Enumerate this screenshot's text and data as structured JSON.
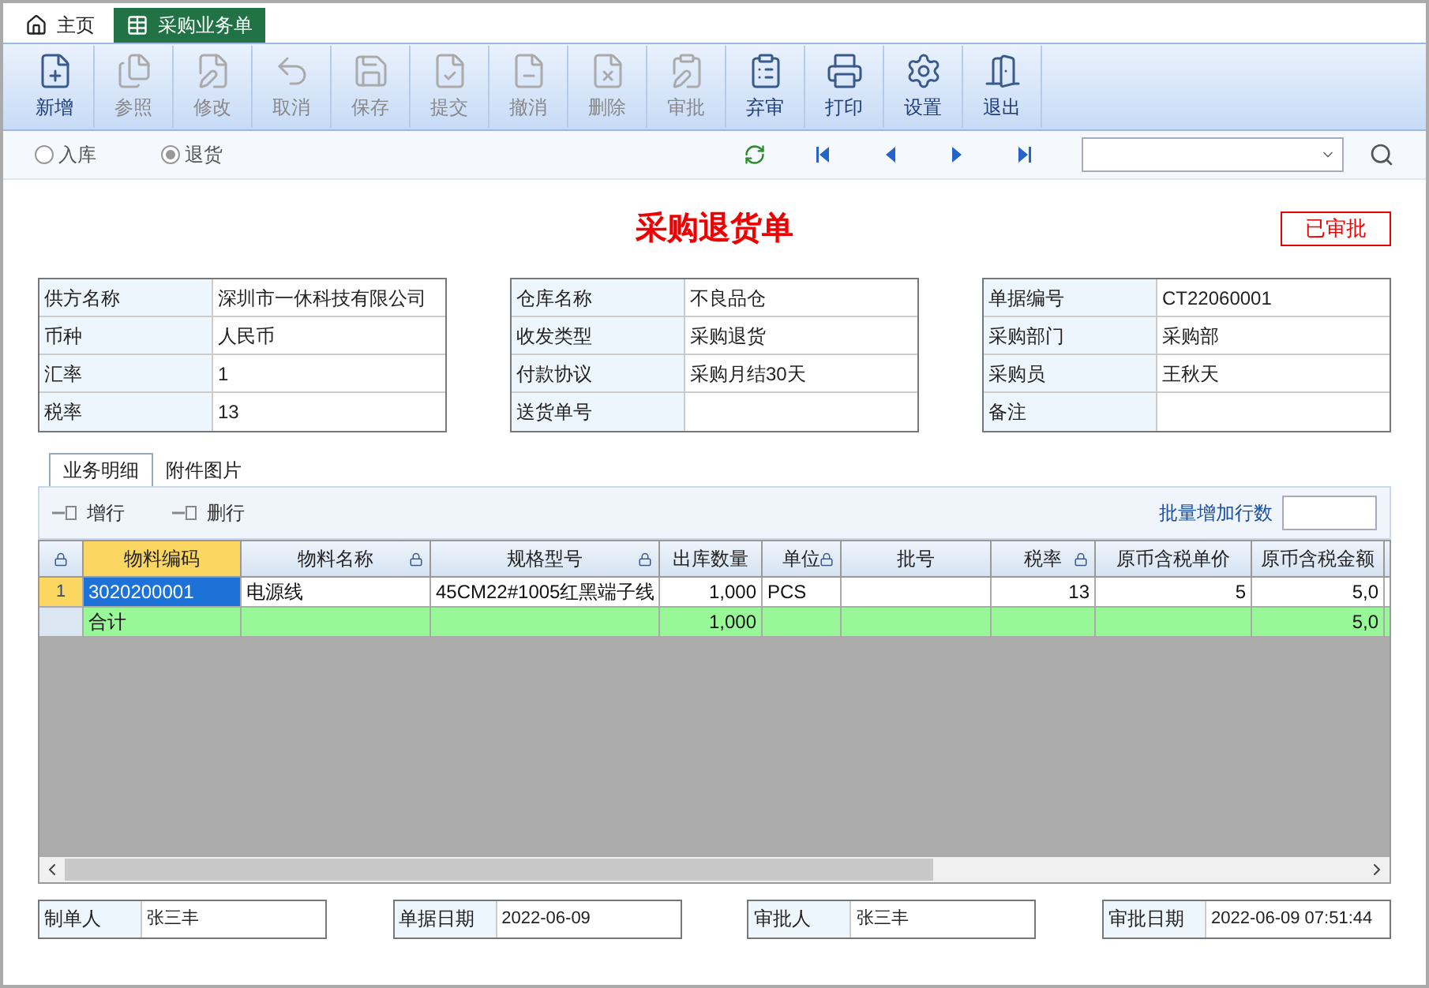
{
  "tabs": [
    {
      "label": "主页",
      "selected": false
    },
    {
      "label": "采购业务单",
      "selected": true
    }
  ],
  "toolbar": [
    {
      "label": "新增",
      "disabled": false
    },
    {
      "label": "参照",
      "disabled": true
    },
    {
      "label": "修改",
      "disabled": true
    },
    {
      "label": "取消",
      "disabled": true
    },
    {
      "label": "保存",
      "disabled": true
    },
    {
      "label": "提交",
      "disabled": true
    },
    {
      "label": "撤消",
      "disabled": true
    },
    {
      "label": "删除",
      "disabled": true
    },
    {
      "label": "审批",
      "disabled": true
    },
    {
      "label": "弃审",
      "disabled": false
    },
    {
      "label": "打印",
      "disabled": false
    },
    {
      "label": "设置",
      "disabled": false
    },
    {
      "label": "退出",
      "disabled": false
    }
  ],
  "radios": [
    {
      "label": "入库",
      "selected": false
    },
    {
      "label": "退货",
      "selected": true
    }
  ],
  "title": "采购退货单",
  "status": "已审批",
  "field_groups": [
    [
      {
        "label": "供方名称",
        "value": "深圳市一休科技有限公司"
      },
      {
        "label": "币种",
        "value": "人民币"
      },
      {
        "label": "汇率",
        "value": "1"
      },
      {
        "label": "税率",
        "value": "13"
      }
    ],
    [
      {
        "label": "仓库名称",
        "value": "不良品仓"
      },
      {
        "label": "收发类型",
        "value": "采购退货"
      },
      {
        "label": "付款协议",
        "value": "采购月结30天"
      },
      {
        "label": "送货单号"
      }
    ],
    [
      {
        "label": "单据编号",
        "value": "CT22060001"
      },
      {
        "label": "采购部门",
        "value": "采购部"
      },
      {
        "label": "采购员",
        "value": "王秋天"
      },
      {
        "label": "备注"
      }
    ]
  ],
  "detail_tabs": [
    {
      "label": "业务明细",
      "selected": true
    },
    {
      "label": "附件图片",
      "selected": false
    }
  ],
  "grid_actions": [
    "增行",
    "删行"
  ],
  "batch_label": "批量增加行数",
  "grid": {
    "columns": [
      {
        "label": "物料编码",
        "locked": false,
        "selected": true
      },
      {
        "label": "物料名称",
        "locked": true,
        "selected": false
      },
      {
        "label": "规格型号",
        "locked": true,
        "selected": false
      },
      {
        "label": "出库数量",
        "locked": false,
        "selected": false
      },
      {
        "label": "单位",
        "locked": true,
        "selected": false
      },
      {
        "label": "批号",
        "locked": false,
        "selected": false
      },
      {
        "label": "税率",
        "locked": true,
        "selected": false
      },
      {
        "label": "原币含税单价",
        "locked": false,
        "selected": false
      },
      {
        "label": "原币含税金额",
        "locked": false,
        "selected": false
      }
    ],
    "rows": [
      {
        "kind": "data",
        "number": "1",
        "selected": true,
        "cells": [
          "3020200001",
          "电源线",
          "45CM22#1005红黑端子线",
          "1,000",
          "PCS",
          "",
          "13",
          "5",
          "5,0"
        ]
      },
      {
        "kind": "total",
        "cells": [
          "合计",
          "",
          "",
          "1,000",
          "",
          "",
          "",
          "",
          "5,0"
        ]
      }
    ]
  },
  "footer": [
    {
      "label": "制单人",
      "value": "张三丰"
    },
    {
      "label": "单据日期",
      "value": "2022-06-09"
    },
    {
      "label": "审批人",
      "value": "张三丰"
    },
    {
      "label": "审批日期",
      "value": "2022-06-09 07:51:44"
    }
  ]
}
